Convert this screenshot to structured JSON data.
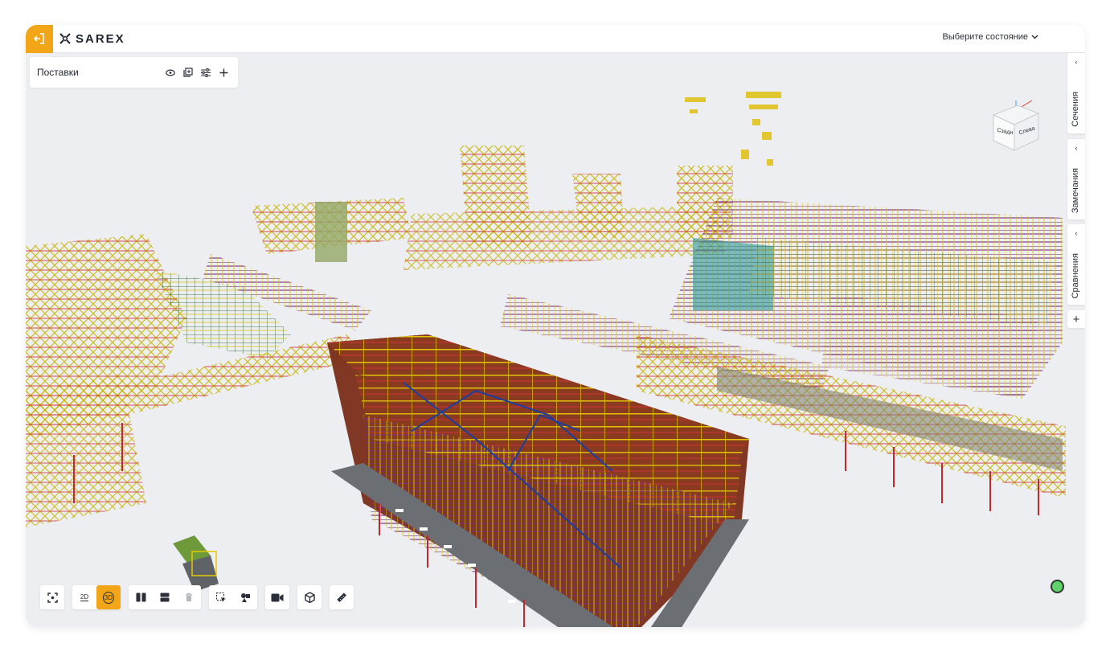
{
  "app": {
    "logo_text": "SAREX",
    "state_select_label": "Выберите состояние",
    "accent_color": "#f2a516",
    "status_color": "#5fd36a"
  },
  "panel": {
    "title": "Поставки",
    "icons": [
      "eye-icon",
      "copy-add-icon",
      "sliders-icon",
      "plus-icon"
    ]
  },
  "right_rail": {
    "tabs": [
      {
        "label": "Сечения"
      },
      {
        "label": "Замечания"
      },
      {
        "label": "Сравнения"
      }
    ],
    "plus_label": "+"
  },
  "navcube": {
    "face_left": "Сзади",
    "face_right": "Слева"
  },
  "toolbar": {
    "mode_2d": "2D",
    "mode_3d": "3D",
    "active_mode": "3D"
  }
}
